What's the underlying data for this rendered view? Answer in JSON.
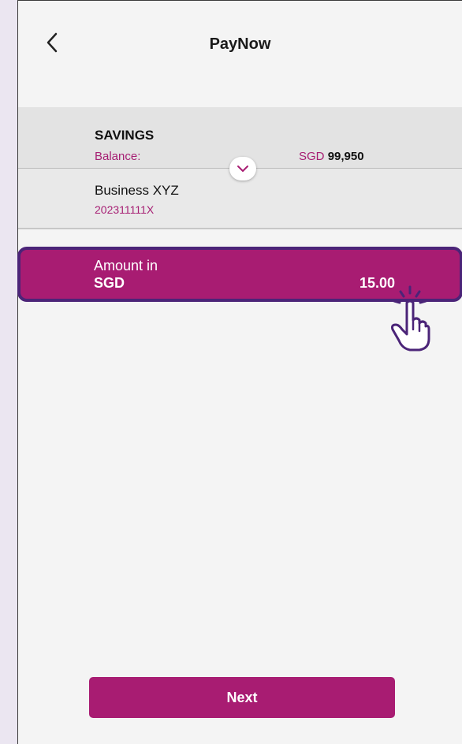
{
  "header": {
    "title": "PayNow",
    "back_icon": "chevron-left-icon"
  },
  "account": {
    "name": "SAVINGS",
    "balance_label": "Balance:",
    "currency": "SGD",
    "balance": "99,950"
  },
  "payee": {
    "name": "Business XYZ",
    "id": "202311111X"
  },
  "amount": {
    "label_line1": "Amount in",
    "label_line2": "SGD",
    "value": "15.00"
  },
  "footer": {
    "next_label": "Next"
  },
  "colors": {
    "brand": "#a81c72",
    "highlight_border": "#4b2478",
    "background": "#ebe6f1"
  }
}
